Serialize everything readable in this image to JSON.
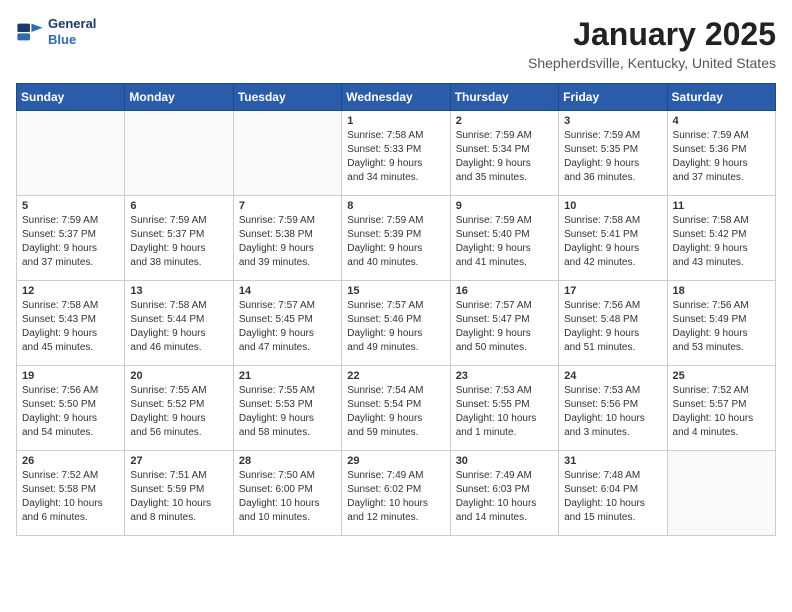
{
  "header": {
    "logo_line1": "General",
    "logo_line2": "Blue",
    "month_year": "January 2025",
    "location": "Shepherdsville, Kentucky, United States"
  },
  "days_of_week": [
    "Sunday",
    "Monday",
    "Tuesday",
    "Wednesday",
    "Thursday",
    "Friday",
    "Saturday"
  ],
  "weeks": [
    [
      {
        "day": "",
        "info": ""
      },
      {
        "day": "",
        "info": ""
      },
      {
        "day": "",
        "info": ""
      },
      {
        "day": "1",
        "info": "Sunrise: 7:58 AM\nSunset: 5:33 PM\nDaylight: 9 hours\nand 34 minutes."
      },
      {
        "day": "2",
        "info": "Sunrise: 7:59 AM\nSunset: 5:34 PM\nDaylight: 9 hours\nand 35 minutes."
      },
      {
        "day": "3",
        "info": "Sunrise: 7:59 AM\nSunset: 5:35 PM\nDaylight: 9 hours\nand 36 minutes."
      },
      {
        "day": "4",
        "info": "Sunrise: 7:59 AM\nSunset: 5:36 PM\nDaylight: 9 hours\nand 37 minutes."
      }
    ],
    [
      {
        "day": "5",
        "info": "Sunrise: 7:59 AM\nSunset: 5:37 PM\nDaylight: 9 hours\nand 37 minutes."
      },
      {
        "day": "6",
        "info": "Sunrise: 7:59 AM\nSunset: 5:37 PM\nDaylight: 9 hours\nand 38 minutes."
      },
      {
        "day": "7",
        "info": "Sunrise: 7:59 AM\nSunset: 5:38 PM\nDaylight: 9 hours\nand 39 minutes."
      },
      {
        "day": "8",
        "info": "Sunrise: 7:59 AM\nSunset: 5:39 PM\nDaylight: 9 hours\nand 40 minutes."
      },
      {
        "day": "9",
        "info": "Sunrise: 7:59 AM\nSunset: 5:40 PM\nDaylight: 9 hours\nand 41 minutes."
      },
      {
        "day": "10",
        "info": "Sunrise: 7:58 AM\nSunset: 5:41 PM\nDaylight: 9 hours\nand 42 minutes."
      },
      {
        "day": "11",
        "info": "Sunrise: 7:58 AM\nSunset: 5:42 PM\nDaylight: 9 hours\nand 43 minutes."
      }
    ],
    [
      {
        "day": "12",
        "info": "Sunrise: 7:58 AM\nSunset: 5:43 PM\nDaylight: 9 hours\nand 45 minutes."
      },
      {
        "day": "13",
        "info": "Sunrise: 7:58 AM\nSunset: 5:44 PM\nDaylight: 9 hours\nand 46 minutes."
      },
      {
        "day": "14",
        "info": "Sunrise: 7:57 AM\nSunset: 5:45 PM\nDaylight: 9 hours\nand 47 minutes."
      },
      {
        "day": "15",
        "info": "Sunrise: 7:57 AM\nSunset: 5:46 PM\nDaylight: 9 hours\nand 49 minutes."
      },
      {
        "day": "16",
        "info": "Sunrise: 7:57 AM\nSunset: 5:47 PM\nDaylight: 9 hours\nand 50 minutes."
      },
      {
        "day": "17",
        "info": "Sunrise: 7:56 AM\nSunset: 5:48 PM\nDaylight: 9 hours\nand 51 minutes."
      },
      {
        "day": "18",
        "info": "Sunrise: 7:56 AM\nSunset: 5:49 PM\nDaylight: 9 hours\nand 53 minutes."
      }
    ],
    [
      {
        "day": "19",
        "info": "Sunrise: 7:56 AM\nSunset: 5:50 PM\nDaylight: 9 hours\nand 54 minutes."
      },
      {
        "day": "20",
        "info": "Sunrise: 7:55 AM\nSunset: 5:52 PM\nDaylight: 9 hours\nand 56 minutes."
      },
      {
        "day": "21",
        "info": "Sunrise: 7:55 AM\nSunset: 5:53 PM\nDaylight: 9 hours\nand 58 minutes."
      },
      {
        "day": "22",
        "info": "Sunrise: 7:54 AM\nSunset: 5:54 PM\nDaylight: 9 hours\nand 59 minutes."
      },
      {
        "day": "23",
        "info": "Sunrise: 7:53 AM\nSunset: 5:55 PM\nDaylight: 10 hours\nand 1 minute."
      },
      {
        "day": "24",
        "info": "Sunrise: 7:53 AM\nSunset: 5:56 PM\nDaylight: 10 hours\nand 3 minutes."
      },
      {
        "day": "25",
        "info": "Sunrise: 7:52 AM\nSunset: 5:57 PM\nDaylight: 10 hours\nand 4 minutes."
      }
    ],
    [
      {
        "day": "26",
        "info": "Sunrise: 7:52 AM\nSunset: 5:58 PM\nDaylight: 10 hours\nand 6 minutes."
      },
      {
        "day": "27",
        "info": "Sunrise: 7:51 AM\nSunset: 5:59 PM\nDaylight: 10 hours\nand 8 minutes."
      },
      {
        "day": "28",
        "info": "Sunrise: 7:50 AM\nSunset: 6:00 PM\nDaylight: 10 hours\nand 10 minutes."
      },
      {
        "day": "29",
        "info": "Sunrise: 7:49 AM\nSunset: 6:02 PM\nDaylight: 10 hours\nand 12 minutes."
      },
      {
        "day": "30",
        "info": "Sunrise: 7:49 AM\nSunset: 6:03 PM\nDaylight: 10 hours\nand 14 minutes."
      },
      {
        "day": "31",
        "info": "Sunrise: 7:48 AM\nSunset: 6:04 PM\nDaylight: 10 hours\nand 15 minutes."
      },
      {
        "day": "",
        "info": ""
      }
    ]
  ]
}
